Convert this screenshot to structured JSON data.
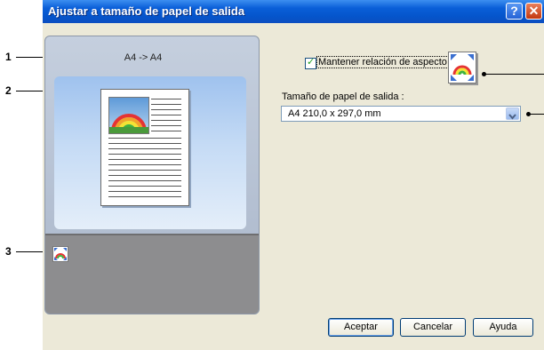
{
  "callouts": [
    "1",
    "2",
    "3"
  ],
  "dialog": {
    "title": "Ajustar a tamaño de papel de salida",
    "help_button": "?",
    "close_button": "✕"
  },
  "preview": {
    "size_conversion": "A4 -> A4"
  },
  "options": {
    "keep_aspect_label": "Mantener relación de aspecto",
    "keep_aspect_checked": true,
    "output_size_label": "Tamaño de papel de salida :",
    "output_size_value": "A4   210,0 x 297,0 mm"
  },
  "buttons": {
    "accept": "Aceptar",
    "cancel": "Cancelar",
    "help": "Ayuda"
  },
  "colors": {
    "titlebar": "#0555cc",
    "dialog_bg": "#ece9d8",
    "close": "#c3380f"
  }
}
